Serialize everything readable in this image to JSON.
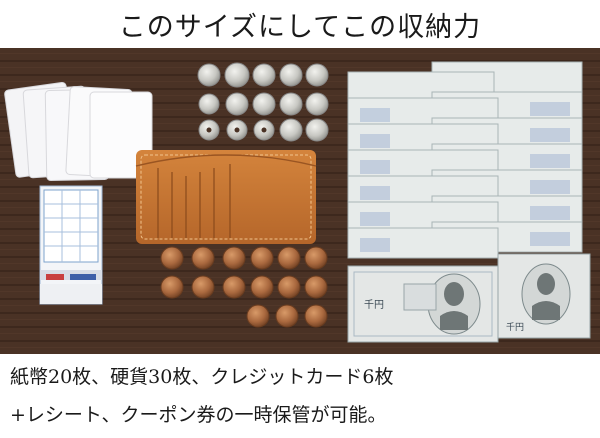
{
  "title": "このサイズにしてこの収納力",
  "caption": {
    "line1": "紙幣20枚、硬貨30枚、クレジットカード6枚",
    "line2": "+レシート、クーポン券の一時保管が可能。"
  },
  "photo": {
    "contents": {
      "cards": 6,
      "coins": 30,
      "banknotes": 20
    },
    "banknote_denomination_marks": [
      "千円",
      "千円"
    ],
    "colors": {
      "table": "#4a3225",
      "wallet": "#c6742f",
      "silver_coin": "#c7c7c2",
      "copper_coin": "#a9683e",
      "banknote": "#e4e7e6"
    }
  }
}
